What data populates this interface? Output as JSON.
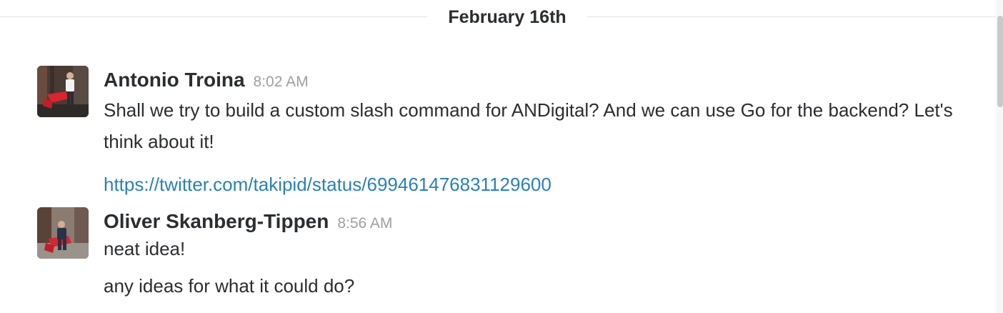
{
  "day_divider": {
    "label": "February 16th"
  },
  "messages": [
    {
      "sender": "Antonio Troina",
      "time": "8:02 AM",
      "lines": [
        "Shall we try to build a custom slash command for ANDigital? And we can use Go for the backend? Let's think about it!"
      ],
      "link": "https://twitter.com/takipid/status/699461476831129600"
    },
    {
      "sender": "Oliver Skanberg-Tippen",
      "time": "8:56 AM",
      "lines": [
        "neat idea!",
        "any ideas for what it could do?"
      ]
    }
  ],
  "colors": {
    "link": "#2a80b9",
    "timestamp": "#9e9ea6",
    "text": "#2c2d30",
    "chair_red": "#d8252e"
  }
}
